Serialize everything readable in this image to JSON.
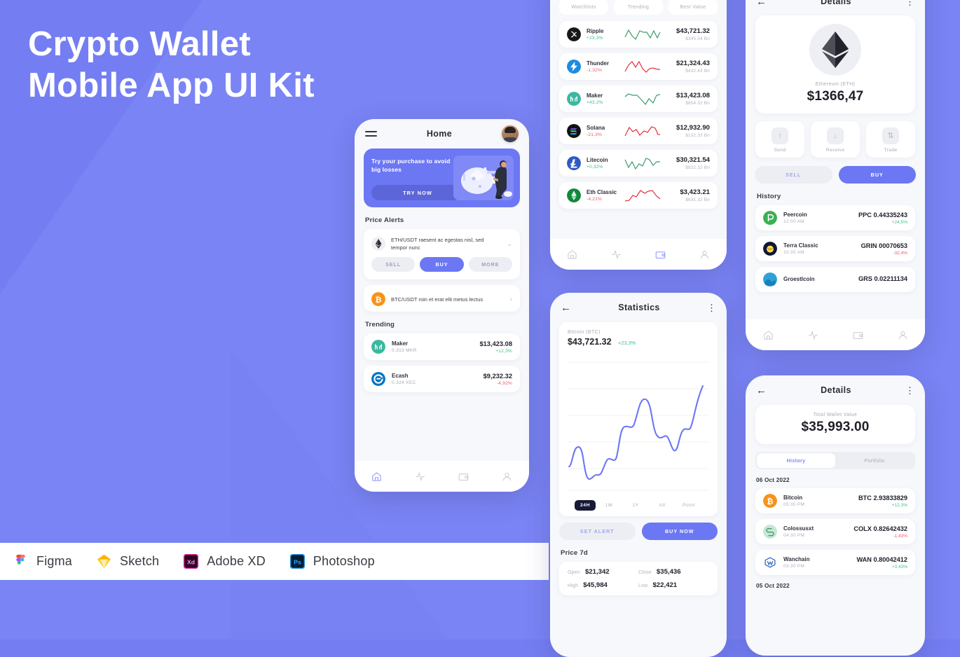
{
  "hero": {
    "line1": "Crypto Wallet",
    "line2": "Mobile App UI Kit"
  },
  "footer": {
    "tools": [
      {
        "name": "Figma",
        "icon": "figma-icon"
      },
      {
        "name": "Sketch",
        "icon": "sketch-icon"
      },
      {
        "name": "Adobe XD",
        "icon": "adobe-xd-icon"
      },
      {
        "name": "Photoshop",
        "icon": "photoshop-icon"
      }
    ]
  },
  "colors": {
    "background": "#747EF2",
    "primary": "#6C77F4",
    "up": "#3FBF8F",
    "down": "#F2556C",
    "card": "#FFFFFF",
    "screen": "#F7F8FB",
    "dark": "#171936"
  },
  "home": {
    "title": "Home",
    "menu_icon": "hamburger-icon",
    "avatar_icon": "user-avatar",
    "banner": {
      "text": "Try your purchase to avoid big losses",
      "cta": "TRY NOW"
    },
    "price_alerts_title": "Price Alerts",
    "alerts": [
      {
        "pair": "ETH/USDT raesent ac egestas nisl, sed tempor nunc",
        "icon": "ethereum-icon",
        "expanded": true,
        "buttons": [
          "SELL",
          "BUY",
          "MORE"
        ]
      },
      {
        "pair": "BTC/USDT roin et erat elit metus lectus",
        "icon": "bitcoin-icon",
        "expanded": false
      }
    ],
    "trending_title": "Trending",
    "trending": [
      {
        "name": "Maker",
        "amount": "0.313 MKR",
        "price": "$13,423.08",
        "change": "+12,3%",
        "dir": "up",
        "icon": "maker-icon"
      },
      {
        "name": "Ecash",
        "amount": "0.324 XEC",
        "price": "$9,232.32",
        "change": "-4,92%",
        "dir": "down",
        "icon": "ecash-icon"
      }
    ],
    "nav": [
      "home-icon",
      "activity-icon",
      "wallet-icon",
      "profile-icon"
    ],
    "nav_active": 0
  },
  "market": {
    "tabs": [
      "Watchlists",
      "Trending",
      "Best Value"
    ],
    "rows": [
      {
        "name": "Ripple",
        "change": "+23,3%",
        "dir": "up",
        "price": "$43,721.32",
        "cap": "$345.54 Bn",
        "icon": "ripple-icon"
      },
      {
        "name": "Thunder",
        "change": "-1.32%",
        "dir": "down",
        "price": "$21,324.43",
        "cap": "$432.43 Bn",
        "icon": "thunder-icon"
      },
      {
        "name": "Maker",
        "change": "+43,2%",
        "dir": "up",
        "price": "$13,423.08",
        "cap": "$654.32 Bn",
        "icon": "maker-icon"
      },
      {
        "name": "Solana",
        "change": "-21,3%",
        "dir": "down",
        "price": "$12,932.90",
        "cap": "$132.33 Bn",
        "icon": "solana-icon"
      },
      {
        "name": "Litecoin",
        "change": "+0,32%",
        "dir": "up",
        "price": "$30,321.54",
        "cap": "$832.32 Bn",
        "icon": "litecoin-icon"
      },
      {
        "name": "Eth Classic",
        "change": "-4,21%",
        "dir": "down",
        "price": "$3,423.21",
        "cap": "$631.32 Bn",
        "icon": "eth-classic-icon"
      }
    ],
    "nav": [
      "home-icon",
      "activity-icon",
      "wallet-icon",
      "profile-icon"
    ],
    "nav_active": 2
  },
  "statistics": {
    "title": "Statistics",
    "coin_label": "Bitcoin (BTC)",
    "price": "$43,721.32",
    "change": "+23,3%",
    "ranges": [
      "24H",
      "1W",
      "1Y",
      "All",
      "Point"
    ],
    "range_active": "24H",
    "buttons": {
      "alert": "SET ALERT",
      "buy": "BUY NOW"
    },
    "price_section_title": "Price 7d",
    "ohlc": [
      {
        "key": "Open",
        "value": "$21,342"
      },
      {
        "key": "Close",
        "value": "$35,436"
      },
      {
        "key": "High",
        "value": "$45,984"
      },
      {
        "key": "Low",
        "value": "$22,421"
      }
    ]
  },
  "details": {
    "title": "Details",
    "coin_name": "Ethereum (ETH)",
    "coin_icon": "ethereum-icon",
    "price": "$1366,47",
    "actions": [
      {
        "label": "Send",
        "icon": "arrow-up-icon"
      },
      {
        "label": "Receive",
        "icon": "arrow-down-icon"
      },
      {
        "label": "Trade",
        "icon": "swap-icon"
      }
    ],
    "sell_label": "SELL",
    "buy_label": "BUY",
    "history_title": "History",
    "history": [
      {
        "name": "Peercoin",
        "time": "12:00 AM",
        "amount": "PPC 0.44335243",
        "change": "+24,5%",
        "dir": "up",
        "icon": "peercoin-icon"
      },
      {
        "name": "Terra Classic",
        "time": "10:35 AM",
        "amount": "GRIN 00070653",
        "change": "-32,4%",
        "dir": "down",
        "icon": "terra-classic-icon"
      },
      {
        "name": "Groestlcoin",
        "time": "",
        "amount": "GRS 0.02211134",
        "change": "",
        "dir": "up",
        "icon": "groestlcoin-icon"
      }
    ],
    "nav": [
      "home-icon",
      "activity-icon",
      "wallet-icon",
      "profile-icon"
    ],
    "nav_active": 0
  },
  "wallet": {
    "title": "Details",
    "total_label": "Total Wallet Value",
    "total_value": "$35,993.00",
    "tabs": [
      "History",
      "Portfolio"
    ],
    "tab_active": "History",
    "date_1": "06 Oct 2022",
    "date_2": "05 Oct 2022",
    "rows": [
      {
        "name": "Bitcoin",
        "time": "05:35 PM",
        "amount": "BTC 2.93833829",
        "change": "+12,3%",
        "dir": "up",
        "icon": "bitcoin-icon"
      },
      {
        "name": "Colossusxt",
        "time": "04:30 PM",
        "amount": "COLX 0.82642432",
        "change": "-1,43%",
        "dir": "down",
        "icon": "colossusxt-icon"
      },
      {
        "name": "Wanchain",
        "time": "03:30 PM",
        "amount": "WAN 0.80042412",
        "change": "+3,43%",
        "dir": "up",
        "icon": "wanchain-icon"
      }
    ]
  },
  "chart_data": {
    "type": "line",
    "title": "Bitcoin (BTC) 24H price",
    "series": [
      {
        "name": "BTC",
        "color": "#6C77F4",
        "values": [
          18,
          14,
          31,
          30,
          5,
          3,
          6,
          7,
          20,
          22,
          17,
          46,
          48,
          44,
          70,
          71,
          84,
          85,
          57,
          56,
          41,
          62,
          66,
          62,
          80,
          95
        ]
      }
    ],
    "ylim": [
      0,
      100
    ],
    "grid": true,
    "xlabel": "",
    "ylabel": ""
  }
}
